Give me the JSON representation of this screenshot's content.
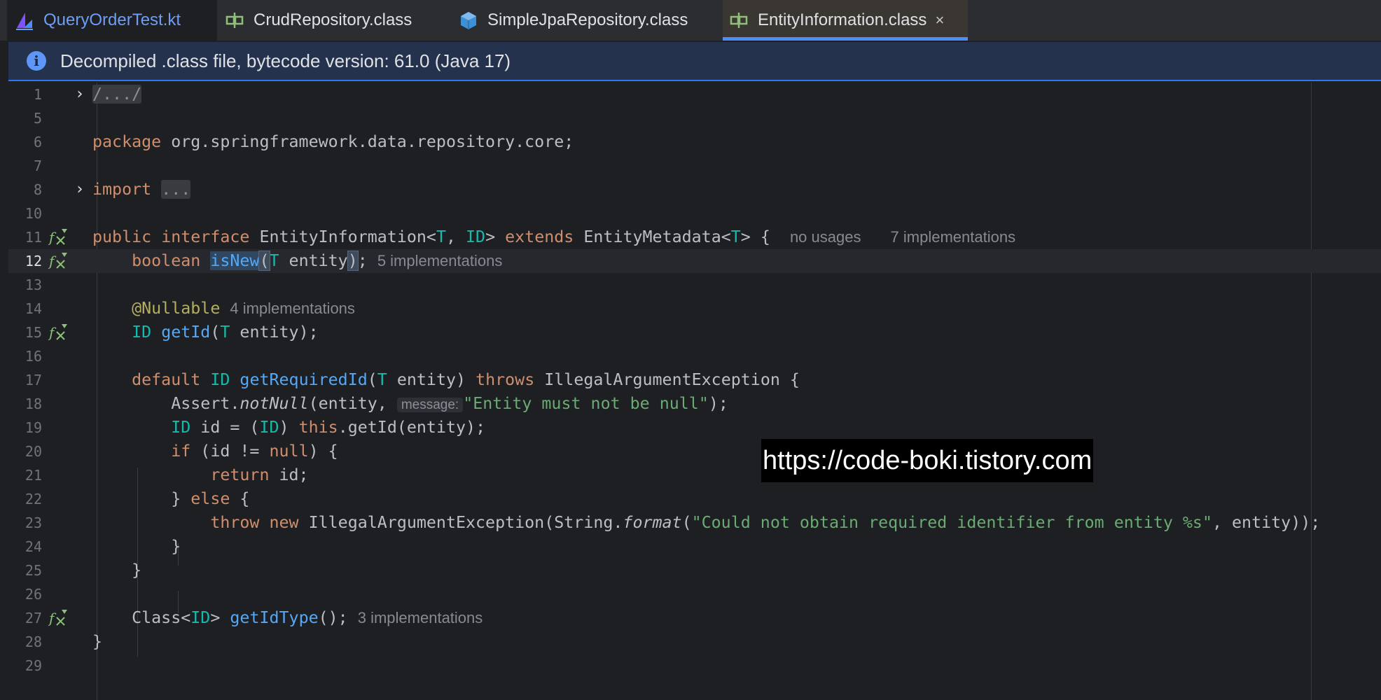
{
  "tabs": [
    {
      "label": "QueryOrderTest.kt",
      "icon": "kotlin-test-icon"
    },
    {
      "label": "CrudRepository.class",
      "icon": "interface-class-icon"
    },
    {
      "label": "SimpleJpaRepository.class",
      "icon": "class-cube-icon"
    },
    {
      "label": "EntityInformation.class",
      "icon": "interface-class-icon",
      "active": true,
      "close": "×"
    }
  ],
  "banner": {
    "text": "Decompiled .class file, bytecode version: 61.0 (Java 17)",
    "icon": "info-icon"
  },
  "line_numbers": [
    "1",
    "5",
    "6",
    "7",
    "8",
    "10",
    "11",
    "12",
    "13",
    "14",
    "15",
    "16",
    "17",
    "18",
    "19",
    "20",
    "21",
    "22",
    "23",
    "24",
    "25",
    "26",
    "27",
    "28",
    "29"
  ],
  "code": {
    "l1": {
      "fold": "/.../"
    },
    "l6": {
      "kw": "package",
      "rest": " org.springframework.data.repository.core;"
    },
    "l8": {
      "kw": "import",
      "fold": "..."
    },
    "l11": {
      "kw1": "public",
      "kw2": "interface",
      "name": "EntityInformation",
      "lt": "<",
      "t": "T",
      "comma": ", ",
      "id": "ID",
      "gt": "> ",
      "kw3": "extends",
      "sup": " EntityMetadata",
      "lt2": "<",
      "t2": "T",
      "end": "> {",
      "hint1": "no usages",
      "hint2": "7 implementations"
    },
    "l12": {
      "kw": "boolean",
      "fn": "isNew",
      "po": "(",
      "t": "T",
      "arg": " entity",
      "pc": ")",
      "semi": ";",
      "hint": "5 implementations"
    },
    "l14": {
      "ann": "@Nullable",
      "hint": "4 implementations"
    },
    "l15": {
      "tp": "ID",
      "fn": "getId",
      "po": "(",
      "t": "T",
      "rest": " entity);"
    },
    "l17": {
      "kw": "default",
      "tp": "ID",
      "fn": "getRequiredId",
      "po": "(",
      "t": "T",
      "arg": " entity) ",
      "kw2": "throws",
      "rest": " IllegalArgumentException {"
    },
    "l18": {
      "pre": "Assert.",
      "fn": "notNull",
      "mid": "(entity, ",
      "inlay": "message:",
      "str": "\"Entity must not be null\"",
      "end": ");"
    },
    "l19": {
      "tp": "ID",
      "mid": " id = (",
      "tp2": "ID",
      "mid2": ") ",
      "kw": "this",
      "rest": ".getId(entity);"
    },
    "l20": {
      "kw": "if",
      "mid": " (id != ",
      "kw2": "null",
      "rest": ") {"
    },
    "l21": {
      "kw": "return",
      "rest": " id;"
    },
    "l22": {
      "pre": "} ",
      "kw": "else",
      "rest": " {"
    },
    "l23": {
      "kw": "throw",
      "kw2": "new",
      "mid": " IllegalArgumentException(String.",
      "fn": "format",
      "po": "(",
      "str": "\"Could not obtain required identifier from entity %s\"",
      "end": ", entity));"
    },
    "l24": {
      "text": "}"
    },
    "l25": {
      "text": "}"
    },
    "l27": {
      "pre": "Class<",
      "tp": "ID",
      "mid": "> ",
      "fn": "getIdType",
      "end": "();",
      "hint": "3 implementations"
    },
    "l28": {
      "text": "}"
    }
  },
  "gutter_icons": "implemented-method-icon",
  "watermark": "https://code-boki.tistory.com",
  "colors": {
    "keyword": "#cf8e6d",
    "function": "#56a8f5",
    "type_param": "#16baac",
    "string": "#6aab73",
    "annotation": "#b3ae60",
    "hint": "#868a91",
    "accent": "#4b8dfa"
  }
}
